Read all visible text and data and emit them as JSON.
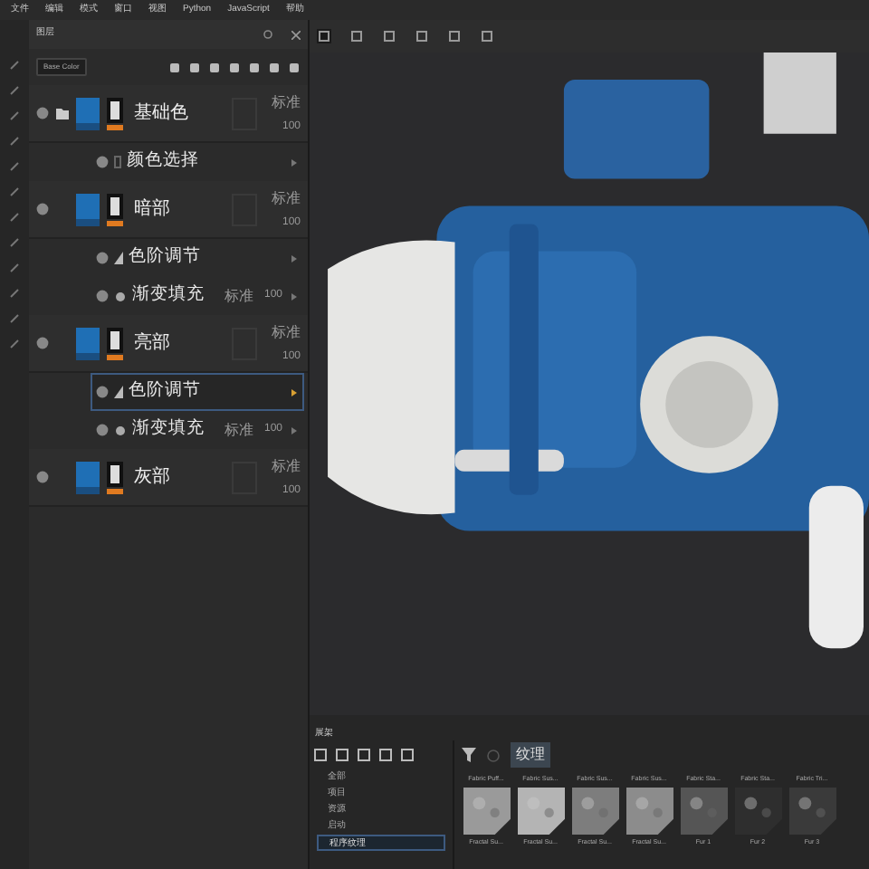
{
  "menu": [
    "文件",
    "编辑",
    "模式",
    "窗口",
    "视图",
    "Python",
    "JavaScript",
    "帮助"
  ],
  "layers_panel": {
    "title": "图层",
    "channel": "Base Color",
    "layers": [
      {
        "name": "基础色",
        "kind": "group",
        "blend": "标准",
        "opacity": "100",
        "selected": false,
        "effects": [
          {
            "name": "颜色选择",
            "kind": "color_select",
            "selected": false
          }
        ]
      },
      {
        "name": "暗部",
        "kind": "layer",
        "blend": "标准",
        "opacity": "100",
        "selected": false,
        "effects": [
          {
            "name": "色阶调节",
            "kind": "levels",
            "selected": false
          },
          {
            "name": "渐变填充",
            "kind": "fill",
            "blend": "标准",
            "opacity": "100",
            "selected": false
          }
        ]
      },
      {
        "name": "亮部",
        "kind": "layer",
        "blend": "标准",
        "opacity": "100",
        "selected": false,
        "effects": [
          {
            "name": "色阶调节",
            "kind": "levels",
            "selected": true
          },
          {
            "name": "渐变填充",
            "kind": "fill",
            "blend": "标准",
            "opacity": "100",
            "selected": false
          }
        ]
      },
      {
        "name": "灰部",
        "kind": "layer",
        "blend": "标准",
        "opacity": "100",
        "selected": false
      }
    ]
  },
  "shelf": {
    "title": "展架",
    "categories": [
      {
        "label": "全部",
        "selected": false
      },
      {
        "label": "项目",
        "selected": false
      },
      {
        "label": "资源",
        "selected": false
      },
      {
        "label": "启动",
        "selected": false
      },
      {
        "label": "程序纹理",
        "selected": true
      }
    ],
    "filter_tag": "纹理",
    "assets": [
      {
        "label": "Fabric Puff...",
        "caption": "Fractal Su..."
      },
      {
        "label": "Fabric Sus...",
        "caption": "Fractal Su..."
      },
      {
        "label": "Fabric Sus...",
        "caption": "Fractal Su..."
      },
      {
        "label": "Fabric Sus...",
        "caption": "Fractal Su..."
      },
      {
        "label": "Fabric Sta...",
        "caption": "Fur 1"
      },
      {
        "label": "Fabric Sta...",
        "caption": "Fur 2"
      },
      {
        "label": "Fabric Tri...",
        "caption": "Fur 3"
      }
    ]
  }
}
